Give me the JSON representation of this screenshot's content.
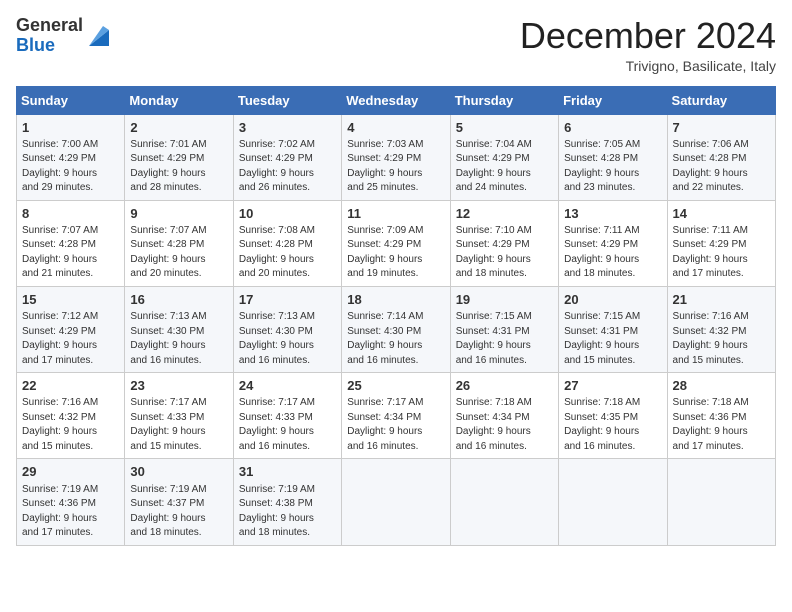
{
  "header": {
    "logo_general": "General",
    "logo_blue": "Blue",
    "title": "December 2024",
    "location": "Trivigno, Basilicate, Italy"
  },
  "days_of_week": [
    "Sunday",
    "Monday",
    "Tuesday",
    "Wednesday",
    "Thursday",
    "Friday",
    "Saturday"
  ],
  "weeks": [
    [
      {
        "day": "1",
        "info": "Sunrise: 7:00 AM\nSunset: 4:29 PM\nDaylight: 9 hours\nand 29 minutes."
      },
      {
        "day": "2",
        "info": "Sunrise: 7:01 AM\nSunset: 4:29 PM\nDaylight: 9 hours\nand 28 minutes."
      },
      {
        "day": "3",
        "info": "Sunrise: 7:02 AM\nSunset: 4:29 PM\nDaylight: 9 hours\nand 26 minutes."
      },
      {
        "day": "4",
        "info": "Sunrise: 7:03 AM\nSunset: 4:29 PM\nDaylight: 9 hours\nand 25 minutes."
      },
      {
        "day": "5",
        "info": "Sunrise: 7:04 AM\nSunset: 4:29 PM\nDaylight: 9 hours\nand 24 minutes."
      },
      {
        "day": "6",
        "info": "Sunrise: 7:05 AM\nSunset: 4:28 PM\nDaylight: 9 hours\nand 23 minutes."
      },
      {
        "day": "7",
        "info": "Sunrise: 7:06 AM\nSunset: 4:28 PM\nDaylight: 9 hours\nand 22 minutes."
      }
    ],
    [
      {
        "day": "8",
        "info": "Sunrise: 7:07 AM\nSunset: 4:28 PM\nDaylight: 9 hours\nand 21 minutes."
      },
      {
        "day": "9",
        "info": "Sunrise: 7:07 AM\nSunset: 4:28 PM\nDaylight: 9 hours\nand 20 minutes."
      },
      {
        "day": "10",
        "info": "Sunrise: 7:08 AM\nSunset: 4:28 PM\nDaylight: 9 hours\nand 20 minutes."
      },
      {
        "day": "11",
        "info": "Sunrise: 7:09 AM\nSunset: 4:29 PM\nDaylight: 9 hours\nand 19 minutes."
      },
      {
        "day": "12",
        "info": "Sunrise: 7:10 AM\nSunset: 4:29 PM\nDaylight: 9 hours\nand 18 minutes."
      },
      {
        "day": "13",
        "info": "Sunrise: 7:11 AM\nSunset: 4:29 PM\nDaylight: 9 hours\nand 18 minutes."
      },
      {
        "day": "14",
        "info": "Sunrise: 7:11 AM\nSunset: 4:29 PM\nDaylight: 9 hours\nand 17 minutes."
      }
    ],
    [
      {
        "day": "15",
        "info": "Sunrise: 7:12 AM\nSunset: 4:29 PM\nDaylight: 9 hours\nand 17 minutes."
      },
      {
        "day": "16",
        "info": "Sunrise: 7:13 AM\nSunset: 4:30 PM\nDaylight: 9 hours\nand 16 minutes."
      },
      {
        "day": "17",
        "info": "Sunrise: 7:13 AM\nSunset: 4:30 PM\nDaylight: 9 hours\nand 16 minutes."
      },
      {
        "day": "18",
        "info": "Sunrise: 7:14 AM\nSunset: 4:30 PM\nDaylight: 9 hours\nand 16 minutes."
      },
      {
        "day": "19",
        "info": "Sunrise: 7:15 AM\nSunset: 4:31 PM\nDaylight: 9 hours\nand 16 minutes."
      },
      {
        "day": "20",
        "info": "Sunrise: 7:15 AM\nSunset: 4:31 PM\nDaylight: 9 hours\nand 15 minutes."
      },
      {
        "day": "21",
        "info": "Sunrise: 7:16 AM\nSunset: 4:32 PM\nDaylight: 9 hours\nand 15 minutes."
      }
    ],
    [
      {
        "day": "22",
        "info": "Sunrise: 7:16 AM\nSunset: 4:32 PM\nDaylight: 9 hours\nand 15 minutes."
      },
      {
        "day": "23",
        "info": "Sunrise: 7:17 AM\nSunset: 4:33 PM\nDaylight: 9 hours\nand 15 minutes."
      },
      {
        "day": "24",
        "info": "Sunrise: 7:17 AM\nSunset: 4:33 PM\nDaylight: 9 hours\nand 16 minutes."
      },
      {
        "day": "25",
        "info": "Sunrise: 7:17 AM\nSunset: 4:34 PM\nDaylight: 9 hours\nand 16 minutes."
      },
      {
        "day": "26",
        "info": "Sunrise: 7:18 AM\nSunset: 4:34 PM\nDaylight: 9 hours\nand 16 minutes."
      },
      {
        "day": "27",
        "info": "Sunrise: 7:18 AM\nSunset: 4:35 PM\nDaylight: 9 hours\nand 16 minutes."
      },
      {
        "day": "28",
        "info": "Sunrise: 7:18 AM\nSunset: 4:36 PM\nDaylight: 9 hours\nand 17 minutes."
      }
    ],
    [
      {
        "day": "29",
        "info": "Sunrise: 7:19 AM\nSunset: 4:36 PM\nDaylight: 9 hours\nand 17 minutes."
      },
      {
        "day": "30",
        "info": "Sunrise: 7:19 AM\nSunset: 4:37 PM\nDaylight: 9 hours\nand 18 minutes."
      },
      {
        "day": "31",
        "info": "Sunrise: 7:19 AM\nSunset: 4:38 PM\nDaylight: 9 hours\nand 18 minutes."
      },
      null,
      null,
      null,
      null
    ]
  ]
}
